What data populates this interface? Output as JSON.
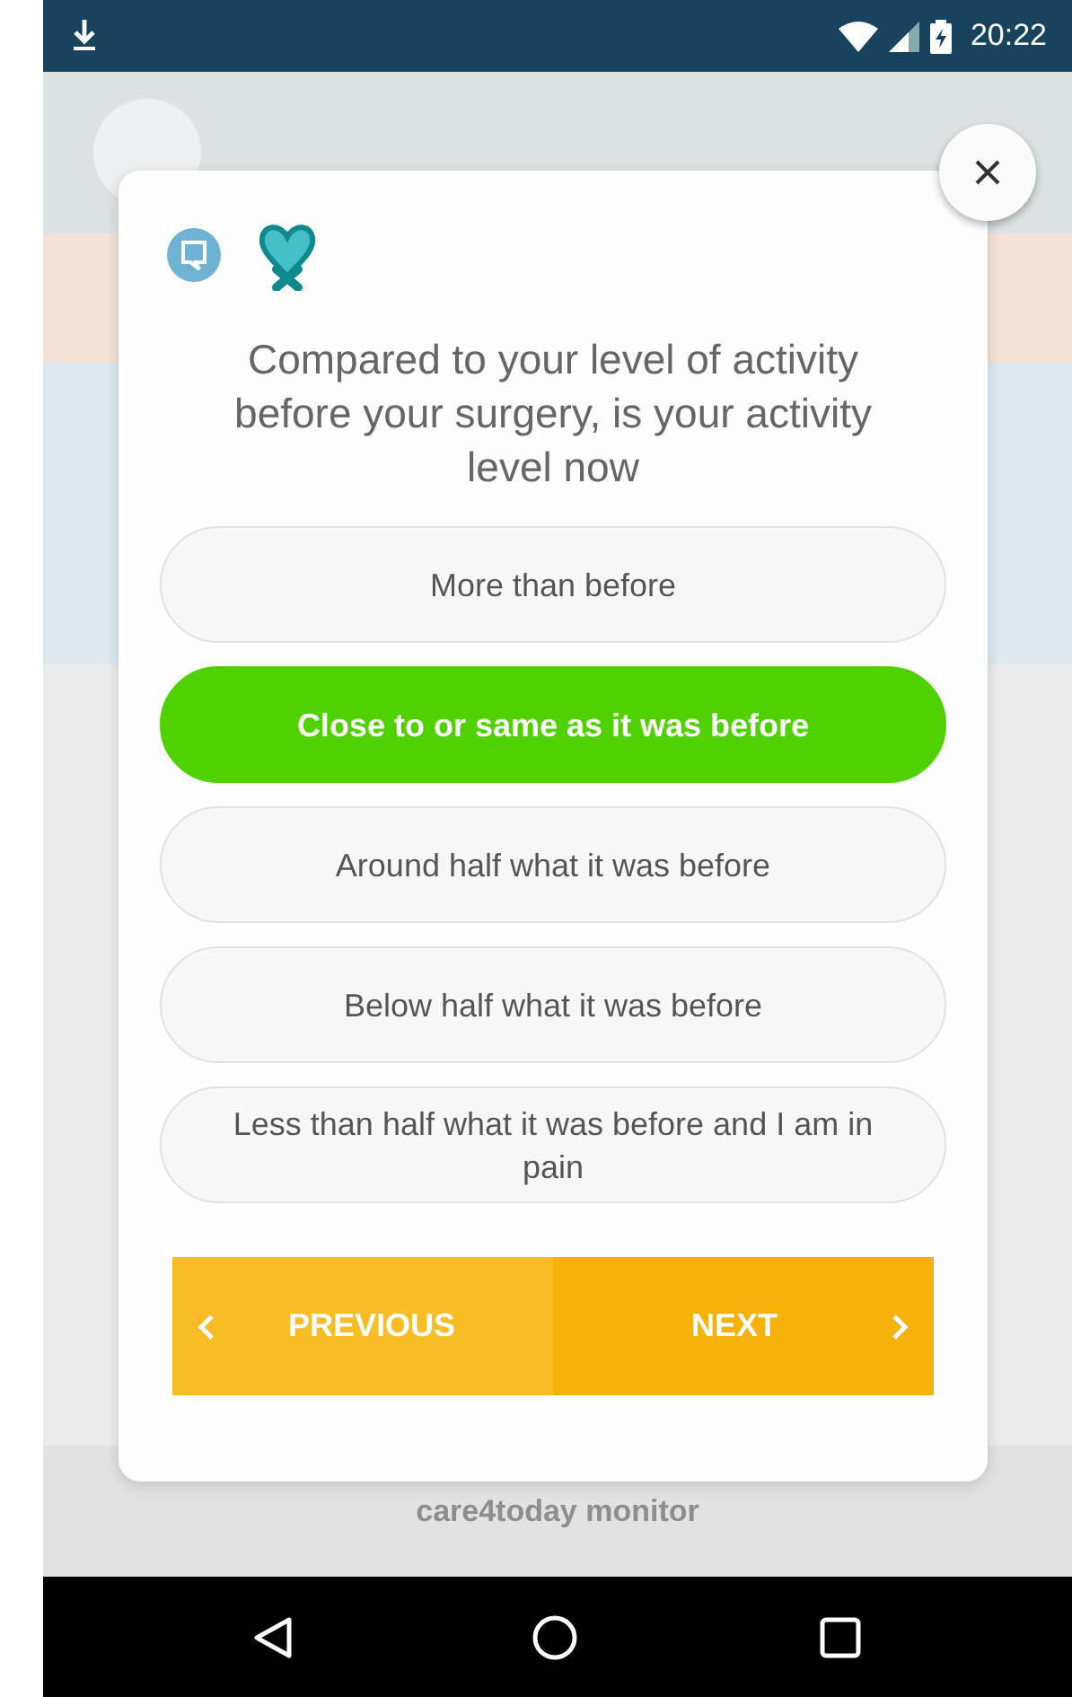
{
  "status_bar": {
    "time": "20:22"
  },
  "background": {
    "footer_title": "care4today monitor"
  },
  "dialog": {
    "question": "Compared to your level of activity before your surgery, is your activity level now",
    "options": [
      {
        "label": "More than before",
        "selected": false
      },
      {
        "label": "Close to or same as it was before",
        "selected": true
      },
      {
        "label": "Around half what it was before",
        "selected": false
      },
      {
        "label": "Below half what it was before",
        "selected": false
      },
      {
        "label": "Less than half what it was before and I am in pain",
        "selected": false
      }
    ],
    "buttons": [
      {
        "label": "PREVIOUS",
        "kind": "previous"
      },
      {
        "label": "NEXT",
        "kind": "next"
      }
    ]
  }
}
